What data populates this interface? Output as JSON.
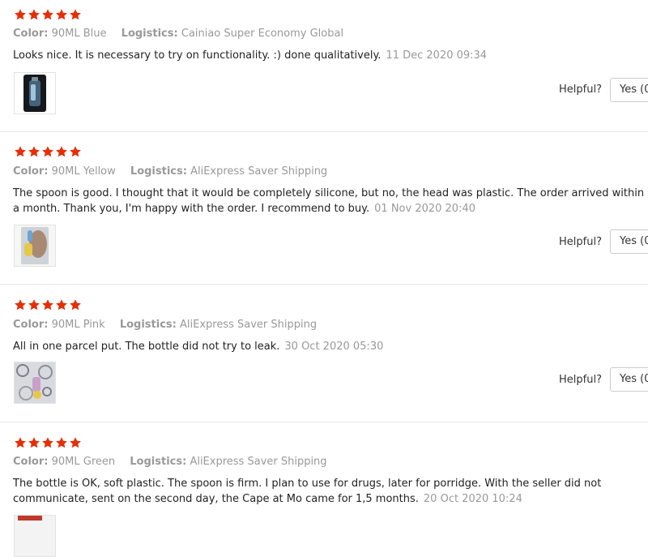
{
  "labels": {
    "color_key": "Color:",
    "logistics_key": "Logistics:",
    "helpful": "Helpful?",
    "yes_button": "Yes (0"
  },
  "star_color": "#e62e04",
  "reviews": [
    {
      "stars": 5,
      "color": "90ML Blue",
      "logistics": "Cainiao Super Economy Global",
      "text": "Looks nice. It is necessary to try on functionality. :) done qualitatively.",
      "date": "11 Dec 2020 09:34"
    },
    {
      "stars": 5,
      "color": "90ML Yellow",
      "logistics": "AliExpress Saver Shipping",
      "text": "The spoon is good. I thought that it would be completely silicone, but no, the head was plastic. The order arrived within a month. Thank you, I'm happy with the order. I recommend to buy.",
      "date": "01 Nov 2020 20:40"
    },
    {
      "stars": 5,
      "color": "90ML Pink",
      "logistics": "AliExpress Saver Shipping",
      "text": "All in one parcel put. The bottle did not try to leak.",
      "date": "30 Oct 2020 05:30"
    },
    {
      "stars": 5,
      "color": "90ML Green",
      "logistics": "AliExpress Saver Shipping",
      "text": "The bottle is OK, soft plastic. The spoon is firm. I plan to use for drugs, later for porridge. With the seller did not communicate, sent on the second day, the Cape at Mo came for 1,5 months.",
      "date": "20 Oct 2020 10:24"
    }
  ]
}
